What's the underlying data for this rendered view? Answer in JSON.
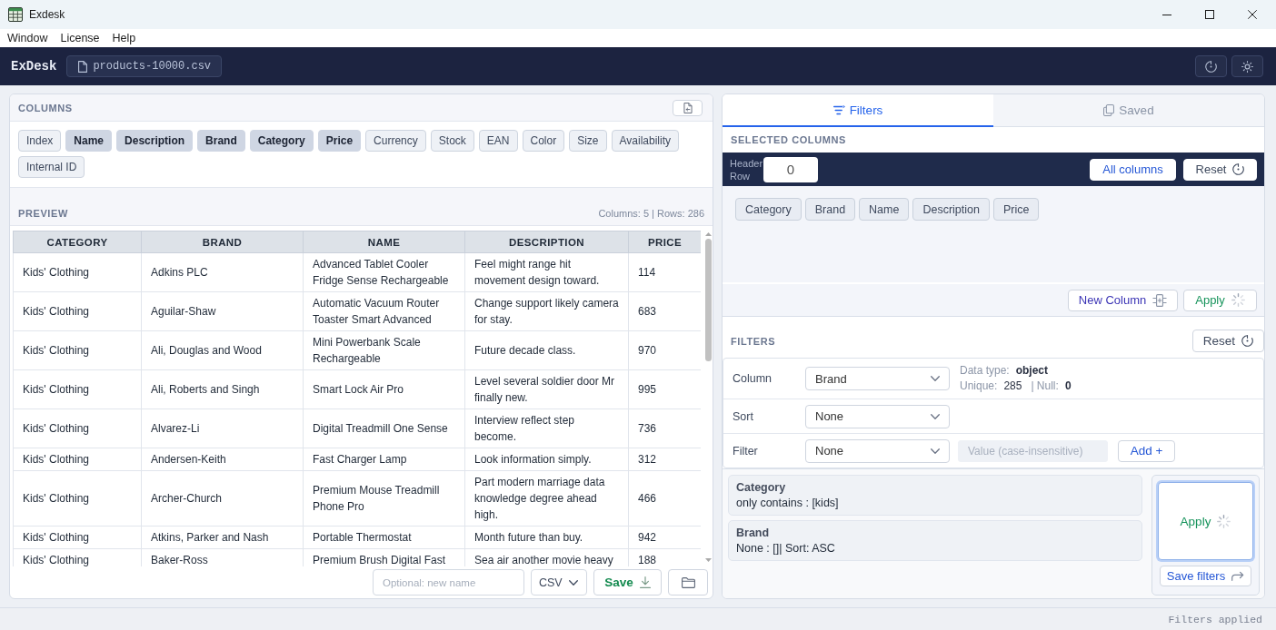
{
  "window": {
    "title": "Exdesk"
  },
  "menu": [
    {
      "label": "Window"
    },
    {
      "label": "License"
    },
    {
      "label": "Help"
    }
  ],
  "header": {
    "app_name": "ExDesk",
    "file_name": "products-10000.csv"
  },
  "columns_panel": {
    "title": "COLUMNS",
    "columns": [
      {
        "label": "Index",
        "selected": false
      },
      {
        "label": "Name",
        "selected": true
      },
      {
        "label": "Description",
        "selected": true
      },
      {
        "label": "Brand",
        "selected": true
      },
      {
        "label": "Category",
        "selected": true
      },
      {
        "label": "Price",
        "selected": true
      },
      {
        "label": "Currency",
        "selected": false
      },
      {
        "label": "Stock",
        "selected": false
      },
      {
        "label": "EAN",
        "selected": false
      },
      {
        "label": "Color",
        "selected": false
      },
      {
        "label": "Size",
        "selected": false
      },
      {
        "label": "Availability",
        "selected": false
      },
      {
        "label": "Internal ID",
        "selected": false
      }
    ]
  },
  "preview": {
    "title": "PREVIEW",
    "summary": "Columns: 5 | Rows: 286",
    "table": {
      "columns": [
        "CATEGORY",
        "BRAND",
        "NAME",
        "DESCRIPTION",
        "PRICE"
      ],
      "rows": [
        [
          "Kids' Clothing",
          "Adkins PLC",
          "Advanced Tablet Cooler Fridge Sense Rechargeable",
          "Feel might range hit movement design toward.",
          "114"
        ],
        [
          "Kids' Clothing",
          "Aguilar-Shaw",
          "Automatic Vacuum Router Toaster Smart Advanced",
          "Change support likely camera for stay.",
          "683"
        ],
        [
          "Kids' Clothing",
          "Ali, Douglas and Wood",
          "Mini Powerbank Scale Rechargeable",
          "Future decade class.",
          "970"
        ],
        [
          "Kids' Clothing",
          "Ali, Roberts and Singh",
          "Smart Lock Air Pro",
          "Level several soldier door Mr finally new.",
          "995"
        ],
        [
          "Kids' Clothing",
          "Alvarez-Li",
          "Digital Treadmill One Sense",
          "Interview reflect step become.",
          "736"
        ],
        [
          "Kids' Clothing",
          "Andersen-Keith",
          "Fast Charger Lamp",
          "Look information simply.",
          "312"
        ],
        [
          "Kids' Clothing",
          "Archer-Church",
          "Premium Mouse Treadmill Phone Pro",
          "Part modern marriage data knowledge degree ahead high.",
          "466"
        ],
        [
          "Kids' Clothing",
          "Atkins, Parker and Nash",
          "Portable Thermostat",
          "Month future than buy.",
          "942"
        ],
        [
          "Kids' Clothing",
          "Baker-Ross",
          "Premium Brush Digital Fast",
          "Sea air another movie heavy",
          "188"
        ]
      ]
    }
  },
  "export": {
    "name_placeholder": "Optional: new name",
    "format": "CSV",
    "save_label": "Save"
  },
  "tabs": [
    {
      "label": "Filters",
      "selected": true
    },
    {
      "label": "Saved",
      "selected": false
    }
  ],
  "selected_columns": {
    "title": "SELECTED COLUMNS",
    "header_row_label": "Header Row",
    "header_row_value": "0",
    "all_columns_label": "All columns",
    "reset_label": "Reset",
    "columns": [
      "Category",
      "Brand",
      "Name",
      "Description",
      "Price"
    ],
    "new_column_label": "New Column",
    "apply_label": "Apply"
  },
  "filters": {
    "title": "FILTERS",
    "reset_label": "Reset",
    "column": {
      "label": "Column",
      "value": "Brand"
    },
    "column_info": {
      "data_type_label": "Data type:",
      "data_type": "object",
      "unique_label": "Unique:",
      "unique": "285",
      "null_label": "| Null:",
      "null": "0"
    },
    "sort": {
      "label": "Sort",
      "value": "None"
    },
    "filter": {
      "label": "Filter",
      "value": "None",
      "value_placeholder": "Value (case-insensitive)",
      "value_disabled": true,
      "add_label": "Add +"
    },
    "applied": [
      {
        "column": "Category",
        "rule": "only contains : [kids]"
      },
      {
        "column": "Brand",
        "rule": "None : []| Sort: ASC"
      }
    ],
    "apply_label": "Apply",
    "apply_focused": true,
    "save_label": "Save filters"
  },
  "status_bar": {
    "text": "Filters applied"
  }
}
